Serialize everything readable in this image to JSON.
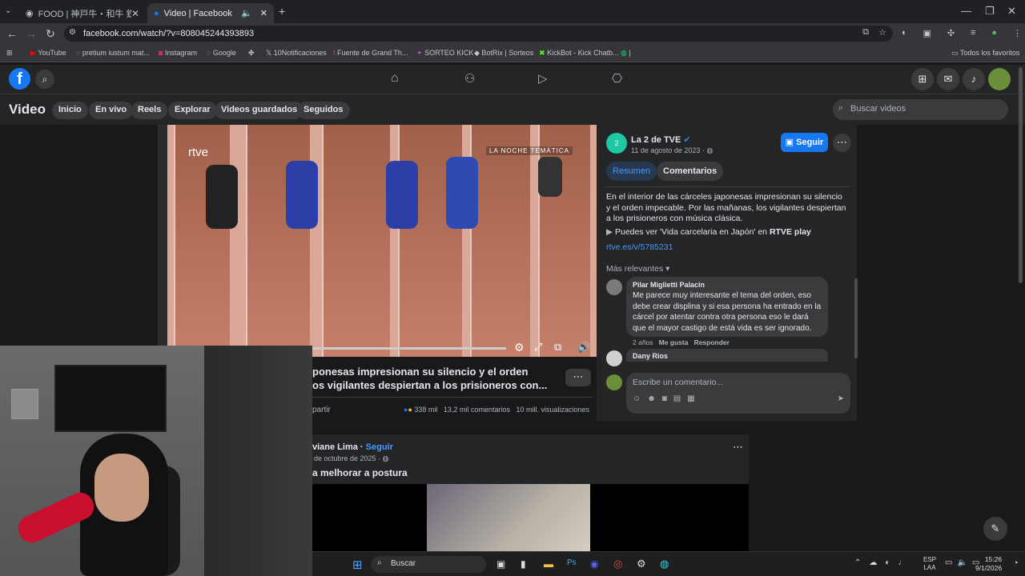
{
  "tabs": [
    {
      "title": "FOOD | 神戸牛・和牛 鉄板焼き 東京"
    },
    {
      "title": "Video | Facebook"
    }
  ],
  "address": {
    "url": "facebook.com/watch/?v=808045244393893"
  },
  "bookmarks": [
    "YouTube",
    "pretium iustum mat...",
    "Instagram",
    "Google",
    "10Notificaciones",
    "Fuente de Grand Th...",
    "SORTEO KICK",
    "BotRix | Sorteos",
    "KickBot - Kick Chatb...",
    "Todos los favoritos"
  ],
  "fb": {
    "section_title": "Video",
    "subnav": [
      "Inicio",
      "En vivo",
      "Reels",
      "Explorar",
      "Videos guardados",
      "Seguidos"
    ],
    "search_placeholder": "Buscar videos",
    "video": {
      "overlay_brand": "rtve",
      "overlay_tag": "LA NOCHE TEMÁTICA",
      "title_line1": "ponesas impresionan su silencio y el orden",
      "title_line2": "os vigilantes despiertan a los prisioneros con...",
      "share": "partir",
      "reactions": "338 mil",
      "comments": "13,2 mil comentarios",
      "views": "10 mill. visualizaciones"
    },
    "page": {
      "name": "La 2 de TVE",
      "date": "11 de agosto de 2023 ·",
      "follow": "Seguir",
      "avatar_letter": "2"
    },
    "tabs": [
      "Resumen",
      "Comentarios"
    ],
    "description": "En el interior de las cárceles japonesas impresionan su silencio y el orden impecable. Por las mañanas, los vigilantes despiertan a los prisioneros con música clásica.",
    "rtve_line_prefix": "Puedes ver 'Vida carcelaria en Japón' en ",
    "rtve_line_bold": "RTVE play",
    "link": "rtve.es/v/5785231",
    "sort": "Más relevantes",
    "comments": [
      {
        "author": "Pilar Miglietti Palacin",
        "text": "Me parece muy interesante el tema del orden, eso debe crear displina y si esa persona ha entrado en la cárcel por atentar contra otra persona eso le dará que el mayor castigo de está vida es ser ignorado.",
        "age": "2 años",
        "like": "Me gusta",
        "reply": "Responder"
      },
      {
        "author": "Dany Rios"
      }
    ],
    "comment_placeholder": "Escribe un comentario...",
    "post": {
      "author": "viane Lima",
      "follow": "Seguir",
      "date": "de octubre de 2025 ·",
      "caption": "a melhorar a postura"
    }
  },
  "taskbar": {
    "search": "Buscar",
    "lang": "ESP",
    "layout": "LAA",
    "time": "15:26",
    "date": "9/1/2026"
  }
}
